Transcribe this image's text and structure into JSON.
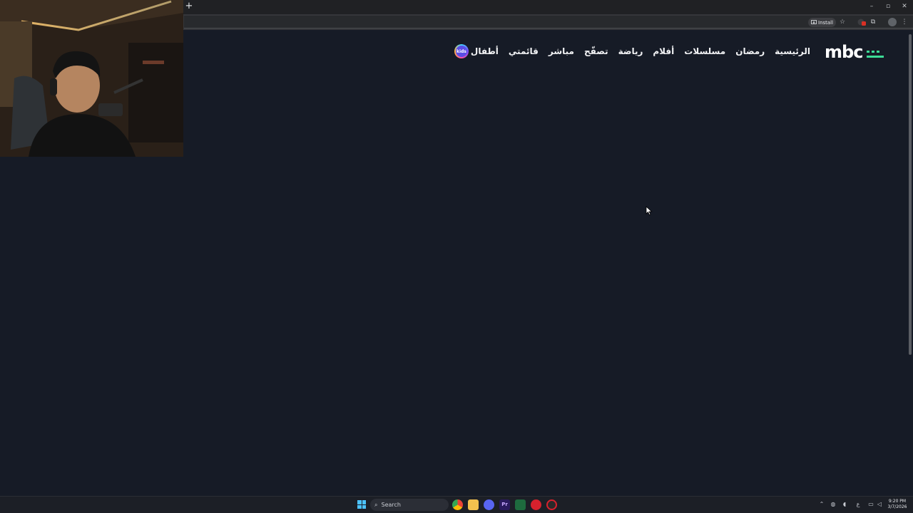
{
  "browser": {
    "newtab_symbol": "+",
    "window_controls": {
      "minimize": "–",
      "maximize": "▫",
      "close": "✕"
    },
    "install_label": "Install",
    "toolbar_icons": [
      "star-icon",
      "extensions-icon",
      "menu-icon"
    ]
  },
  "site": {
    "logo_text": "mbc",
    "logo_colors": {
      "text": "#ffffff",
      "bars": "#3ddc97"
    },
    "nav": {
      "home": "الرئيسية",
      "ramadan": "رمضان",
      "series": "مسلسلات",
      "movies": "أفلام",
      "sports": "رياضة",
      "browse": "تصفّح",
      "live": "مباشر",
      "my_list": "قائمتي",
      "kids_label": "أطفال",
      "kids_badge": "kids"
    },
    "background": "#161b26"
  },
  "taskbar": {
    "search_label": "Search",
    "apps": [
      "chrome-icon",
      "file-explorer-icon",
      "discord-icon",
      "premiere-icon",
      "excel-icon",
      "red-app-icon",
      "obs-icon"
    ],
    "tray": [
      "chevron-up-icon",
      "network-icon",
      "mic-icon",
      "language-icon",
      "display-icon",
      "volume-icon"
    ],
    "clock_time": "9:20 PM",
    "clock_date": "3/7/2026"
  }
}
